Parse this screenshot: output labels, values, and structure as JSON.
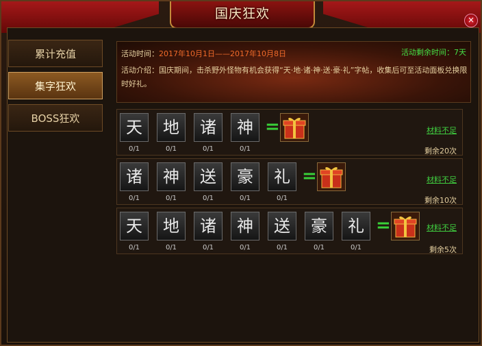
{
  "title": "国庆狂欢",
  "close_label": "×",
  "sidebar": {
    "items": [
      {
        "label": "累计充值"
      },
      {
        "label": "集字狂欢"
      },
      {
        "label": "BOSS狂欢"
      }
    ]
  },
  "info": {
    "time_label": "活动时间：",
    "time_value": "2017年10月1日——2017年10月8日",
    "remaining": "活动剩余时间：7天",
    "intro": "活动介绍：国庆期间，击杀野外怪物有机会获得“天·地·诸·神·送·豪·礼”字帖，收集后可至活动面板兑换限时好礼。"
  },
  "rows": [
    {
      "chars": [
        "天",
        "地",
        "诸",
        "神"
      ],
      "counts": [
        "0/1",
        "0/1",
        "0/1",
        "0/1"
      ],
      "eq": "=",
      "status": "材料不足",
      "times": "剩余20次"
    },
    {
      "chars": [
        "诸",
        "神",
        "送",
        "豪",
        "礼"
      ],
      "counts": [
        "0/1",
        "0/1",
        "0/1",
        "0/1",
        "0/1"
      ],
      "eq": "=",
      "status": "材料不足",
      "times": "剩余10次"
    },
    {
      "chars": [
        "天",
        "地",
        "诸",
        "神",
        "送",
        "豪",
        "礼"
      ],
      "counts": [
        "0/1",
        "0/1",
        "0/1",
        "0/1",
        "0/1",
        "0/1",
        "0/1"
      ],
      "eq": "=",
      "status": "材料不足",
      "times": "剩余5次"
    }
  ],
  "colors": {
    "accent_green": "#40d040",
    "date_orange": "#f06a2a",
    "gold_text": "#e6d0a0"
  },
  "icons": {
    "gift": "gift-box-icon",
    "close": "close-icon"
  }
}
